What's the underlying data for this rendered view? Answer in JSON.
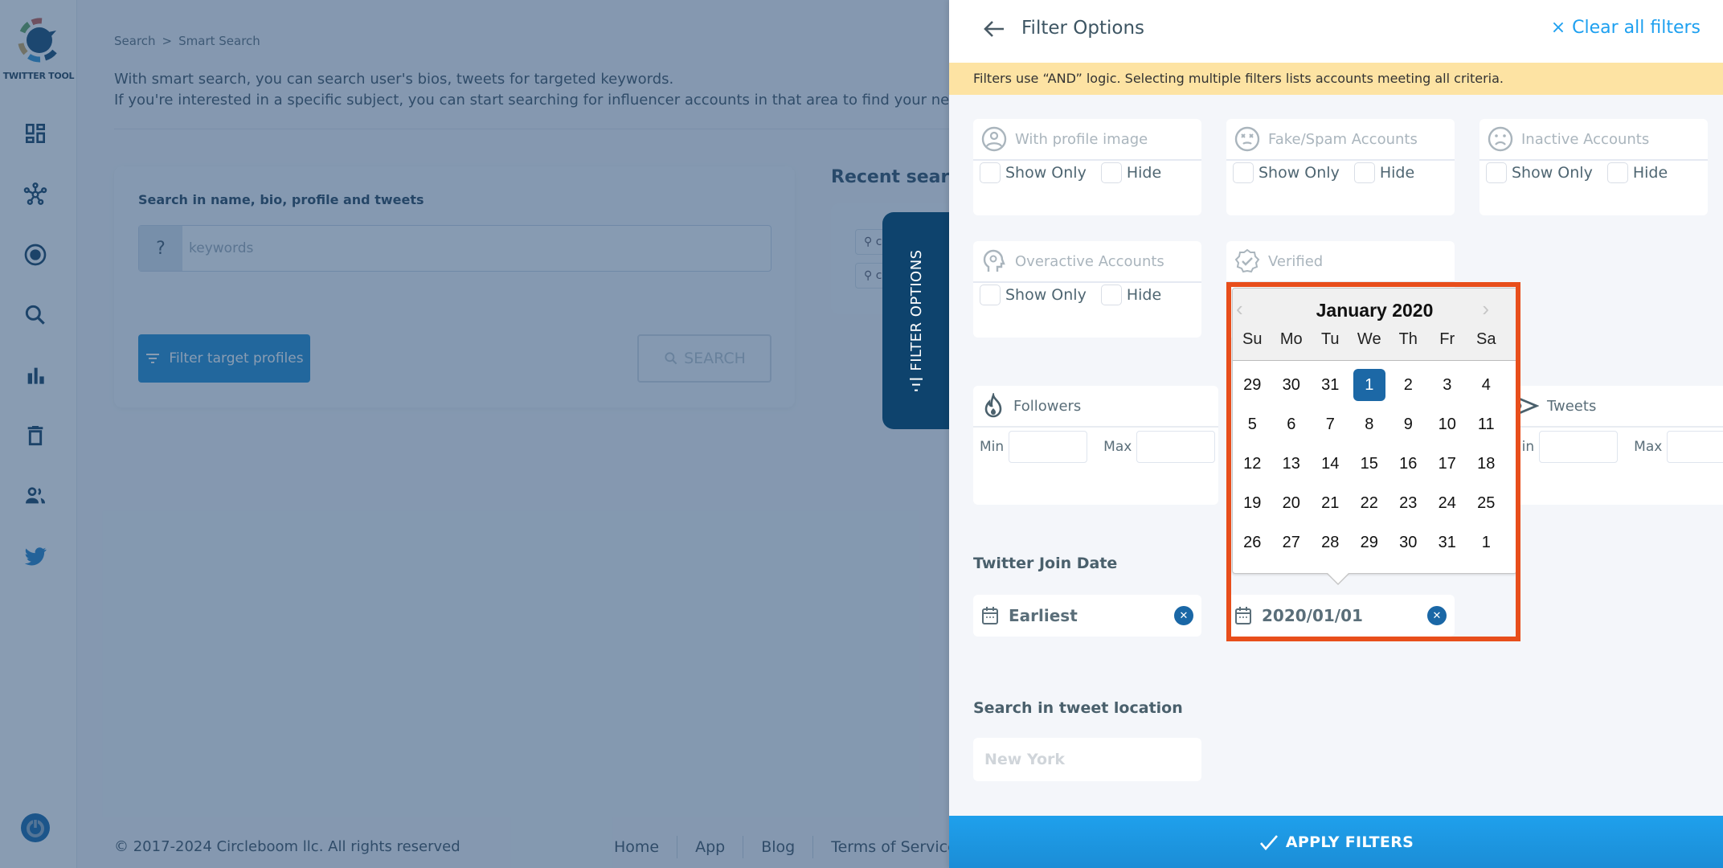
{
  "sidebar": {
    "logo_text": "TWITTER TOOL",
    "items": [
      {
        "icon": "dashboard-icon"
      },
      {
        "icon": "network-icon"
      },
      {
        "icon": "radio-target-icon"
      },
      {
        "icon": "search-icon"
      },
      {
        "icon": "bar-chart-icon"
      },
      {
        "icon": "trash-icon"
      },
      {
        "icon": "users-icon"
      },
      {
        "icon": "twitter-bird-icon"
      }
    ],
    "power_icon": "power-icon"
  },
  "main": {
    "breadcrumb": [
      "Search",
      "Smart Search"
    ],
    "intro_line1": "With smart search, you can search user's bios, tweets for targeted keywords.",
    "intro_line2": "If you're interested in a specific subject, you can start searching for influencer accounts in that area to find your new",
    "search_label": "Search in name, bio, profile and tweets",
    "keyword_prefix": "?",
    "keyword_placeholder": "keywords",
    "filter_button": "Filter target profiles",
    "search_button": "SEARCH",
    "recent_title": "Recent search",
    "recent_items": [
      "c",
      "c"
    ],
    "filter_tab": "FILTER OPTIONS",
    "footer_copy": "© 2017-2024 Circleboom llc. All rights reserved",
    "footer_links": [
      "Home",
      "App",
      "Blog",
      "Terms of Service"
    ]
  },
  "panel": {
    "title": "Filter Options",
    "clear_all": "Clear all filters",
    "notice": "Filters use “AND” logic. Selecting multiple filters lists accounts meeting all criteria.",
    "show_only": "Show Only",
    "hide": "Hide",
    "filters": [
      {
        "label": "With profile image",
        "icon": "profile-image-icon"
      },
      {
        "label": "Fake/Spam Accounts",
        "icon": "dizzy-face-icon"
      },
      {
        "label": "Inactive Accounts",
        "icon": "sad-face-icon"
      },
      {
        "label": "Overactive Accounts",
        "icon": "head-gear-icon"
      },
      {
        "label": "Verified",
        "icon": "verified-badge-icon"
      }
    ],
    "followers": {
      "label": "Followers",
      "min": "Min",
      "max": "Max"
    },
    "tweets": {
      "label": "Tweets",
      "min": "Min",
      "max": "Max"
    },
    "join_date_label": "Twitter Join Date",
    "date_from": "Earliest",
    "date_to": "2020/01/01",
    "location_label": "Search in tweet location",
    "location_placeholder": "New York",
    "apply": "APPLY FILTERS"
  },
  "datepicker": {
    "title": "January 2020",
    "prev": "‹",
    "next": "›",
    "weekdays": [
      "Su",
      "Mo",
      "Tu",
      "We",
      "Th",
      "Fr",
      "Sa"
    ],
    "weeks": [
      [
        "29",
        "30",
        "31",
        "1",
        "2",
        "3",
        "4"
      ],
      [
        "5",
        "6",
        "7",
        "8",
        "9",
        "10",
        "11"
      ],
      [
        "12",
        "13",
        "14",
        "15",
        "16",
        "17",
        "18"
      ],
      [
        "19",
        "20",
        "21",
        "22",
        "23",
        "24",
        "25"
      ],
      [
        "26",
        "27",
        "28",
        "29",
        "30",
        "31",
        "1"
      ]
    ],
    "selected": "2020-01-01",
    "accent": "#1c68a6",
    "highlight_color": "#e84e1b"
  },
  "colors": {
    "brand_dark": "#0e436d",
    "link": "#1ea0f0",
    "apply": "#1fa0ec",
    "notice_bg": "#fde3a3"
  }
}
